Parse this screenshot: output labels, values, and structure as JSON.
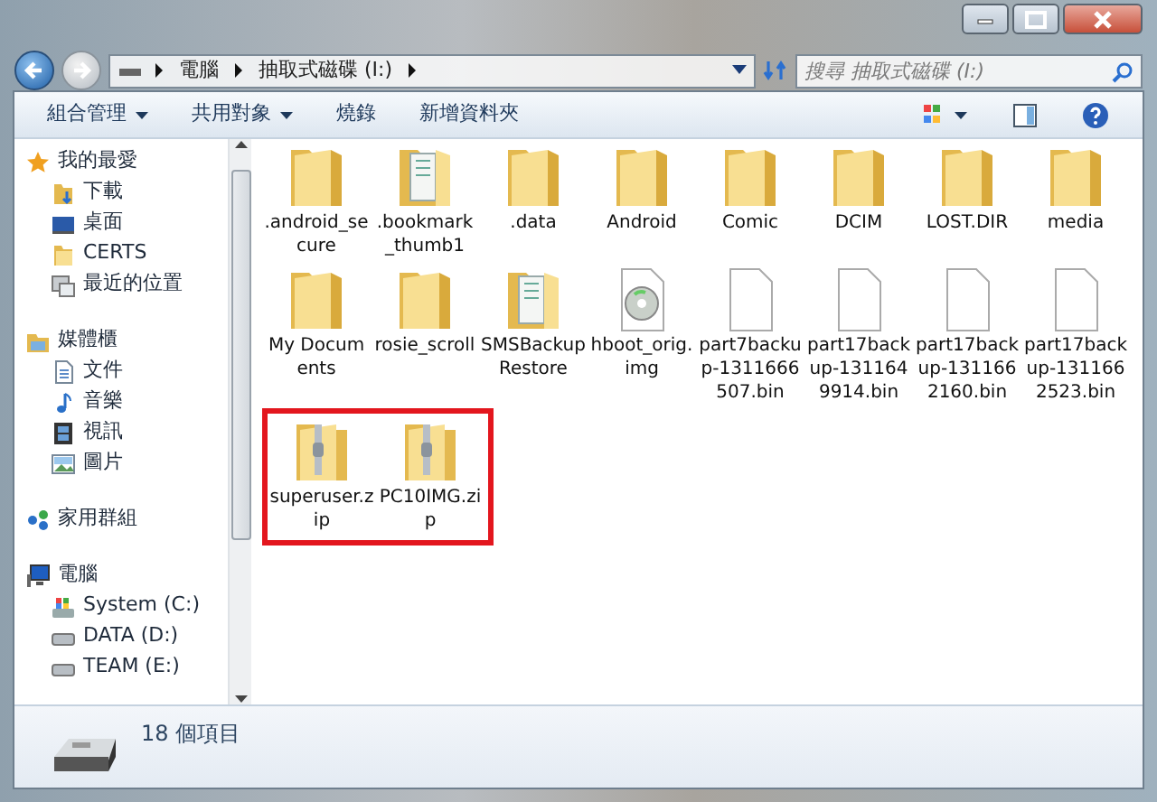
{
  "address_bar": {
    "breadcrumbs": [
      "電腦",
      "抽取式磁碟 (I:)"
    ],
    "search_placeholder": "搜尋 抽取式磁碟 (I:)"
  },
  "toolbar": {
    "buttons": [
      {
        "label": "組合管理",
        "dropdown": true
      },
      {
        "label": "共用對象",
        "dropdown": true
      },
      {
        "label": "燒錄",
        "dropdown": false
      },
      {
        "label": "新增資料夾",
        "dropdown": false
      }
    ]
  },
  "sidebar": {
    "groups": [
      {
        "label": "我的最愛",
        "kind": "star",
        "children": [
          {
            "label": "下載",
            "kind": "download"
          },
          {
            "label": "桌面",
            "kind": "desktop"
          },
          {
            "label": "CERTS",
            "kind": "folder"
          },
          {
            "label": "最近的位置",
            "kind": "recent"
          }
        ]
      },
      {
        "label": "媒體櫃",
        "kind": "library",
        "children": [
          {
            "label": "文件",
            "kind": "document"
          },
          {
            "label": "音樂",
            "kind": "music"
          },
          {
            "label": "視訊",
            "kind": "video"
          },
          {
            "label": "圖片",
            "kind": "picture"
          }
        ]
      },
      {
        "label": "家用群組",
        "kind": "homegroup"
      },
      {
        "label": "電腦",
        "kind": "computer",
        "children": [
          {
            "label": "System (C:)",
            "kind": "system-drive"
          },
          {
            "label": "DATA (D:)",
            "kind": "drive"
          },
          {
            "label": "TEAM (E:)",
            "kind": "drive"
          }
        ]
      }
    ]
  },
  "files": [
    {
      "name": ".android_secure",
      "kind": "folder"
    },
    {
      "name": ".bookmark_thumb1",
      "kind": "doc-folder"
    },
    {
      "name": ".data",
      "kind": "folder"
    },
    {
      "name": "Android",
      "kind": "folder"
    },
    {
      "name": "Comic",
      "kind": "folder"
    },
    {
      "name": "DCIM",
      "kind": "folder"
    },
    {
      "name": "LOST.DIR",
      "kind": "folder"
    },
    {
      "name": "media",
      "kind": "folder"
    },
    {
      "name": "My Documents",
      "kind": "folder"
    },
    {
      "name": "rosie_scroll",
      "kind": "folder"
    },
    {
      "name": "SMSBackupRestore",
      "kind": "doc-folder"
    },
    {
      "name": "hboot_orig.img",
      "kind": "disc-image"
    },
    {
      "name": "part7backup-1311666507.bin",
      "kind": "file"
    },
    {
      "name": "part17backup-1311649914.bin",
      "kind": "file"
    },
    {
      "name": "part17backup-1311662160.bin",
      "kind": "file"
    },
    {
      "name": "part17backup-1311662523.bin",
      "kind": "file"
    }
  ],
  "marked_files": [
    {
      "name": "superuser.zip",
      "kind": "zip"
    },
    {
      "name": "PC10IMG.zip",
      "kind": "zip"
    }
  ],
  "details": {
    "item_count": "18 個項目"
  }
}
